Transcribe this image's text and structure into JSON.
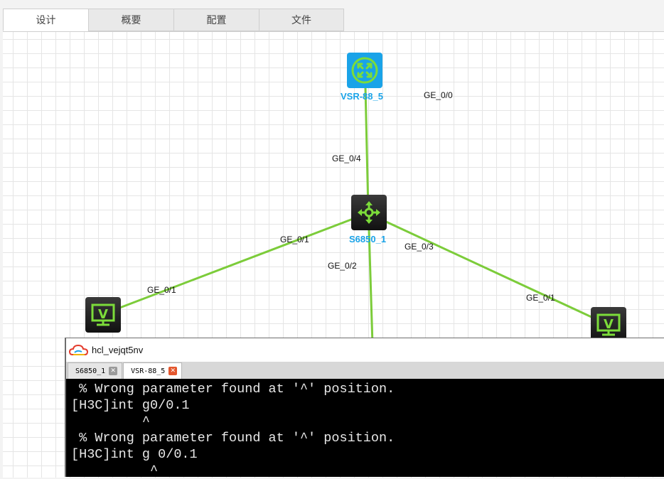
{
  "tabs": [
    {
      "label": "设计"
    },
    {
      "label": "概要"
    },
    {
      "label": "配置"
    },
    {
      "label": "文件"
    }
  ],
  "topology": {
    "devices": {
      "router": {
        "name": "VSR-88_5",
        "icon": "router-icon"
      },
      "switch": {
        "name": "S6850_1",
        "icon": "switch-icon"
      },
      "pc_left": {
        "name": "",
        "icon": "pc-icon"
      },
      "pc_right": {
        "name": "",
        "icon": "pc-icon"
      }
    },
    "ports": {
      "router_ge00": "GE_0/0",
      "switch_ge04": "GE_0/4",
      "switch_ge01": "GE_0/1",
      "switch_ge02": "GE_0/2",
      "switch_ge03": "GE_0/3",
      "pc_left_ge01": "GE_0/1",
      "pc_right_ge01": "GE_0/1"
    },
    "link_color": "#7ccc3a"
  },
  "console": {
    "title": "hcl_vejqt5nv",
    "tabs": [
      {
        "label": "S6850_1"
      },
      {
        "label": "VSR-88_5"
      }
    ],
    "lines": [
      " % Wrong parameter found at '^' position.",
      "[H3C]int g0/0.1",
      "         ^",
      " % Wrong parameter found at '^' position.",
      "[H3C]int g 0/0.1",
      "          ^"
    ]
  }
}
